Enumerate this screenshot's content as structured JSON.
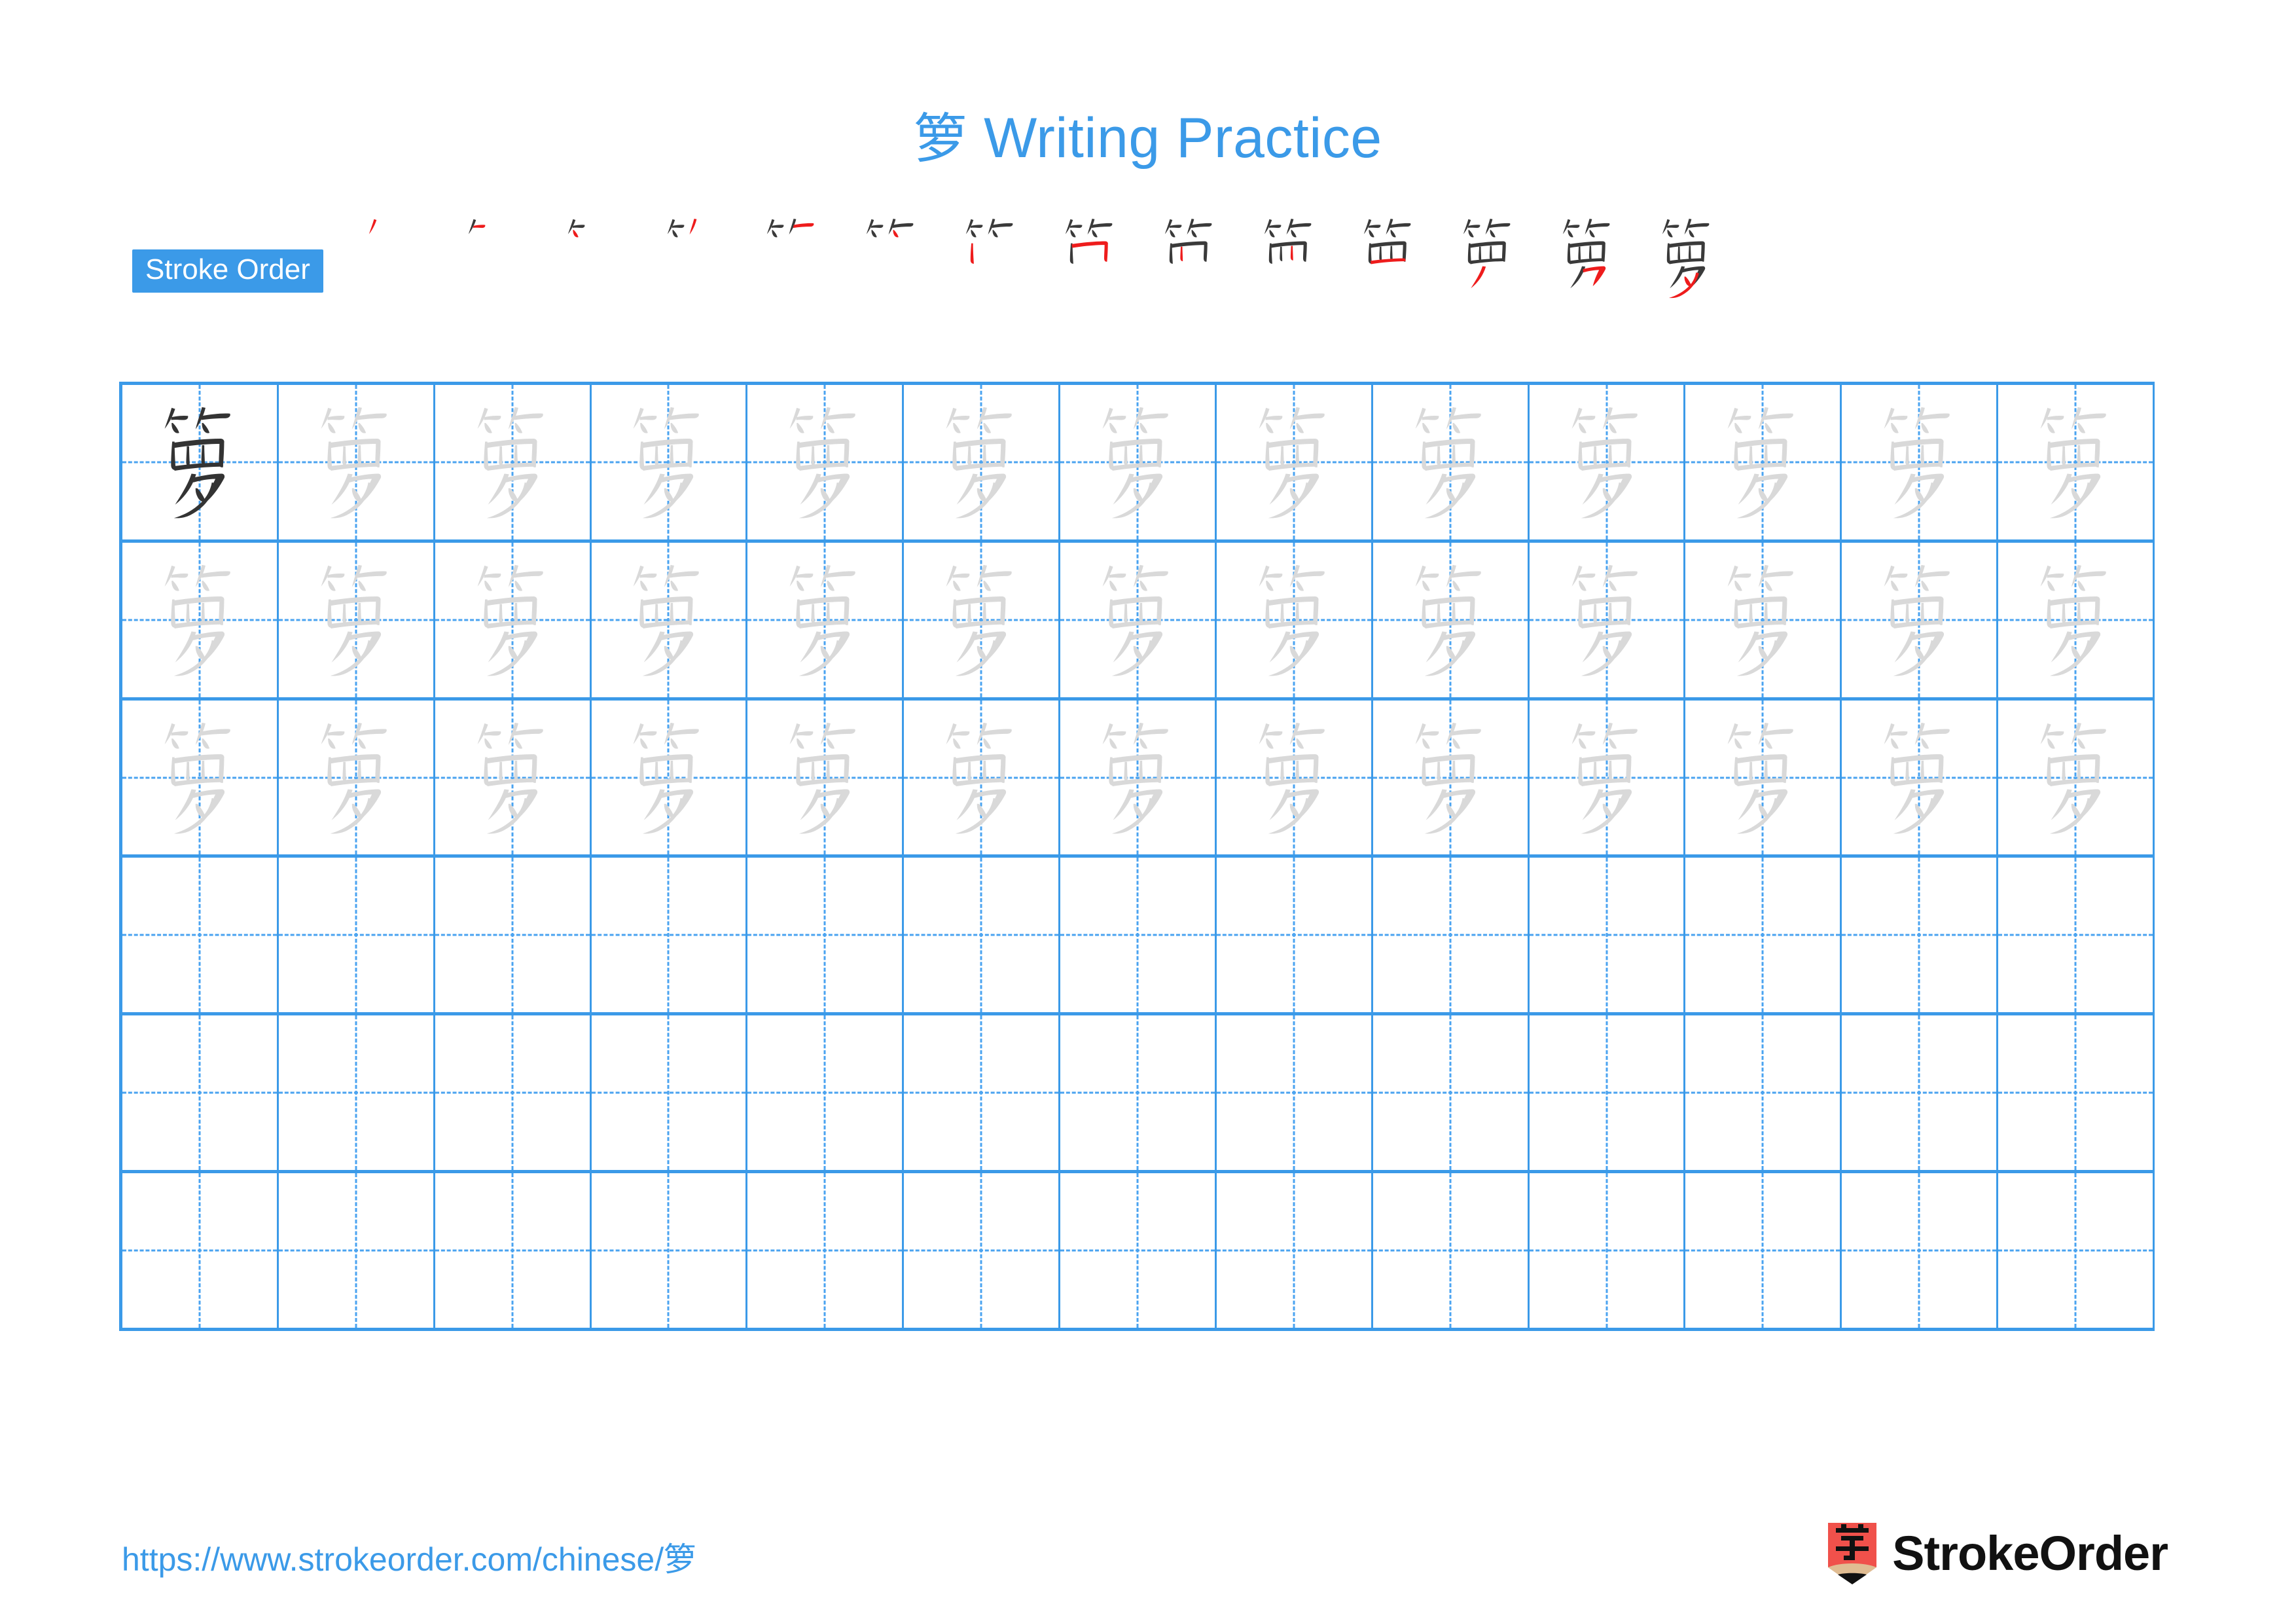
{
  "character": "箩",
  "title": {
    "character": "箩",
    "text": " Writing Practice",
    "full": "箩 Writing Practice",
    "color": "#3b9ae8"
  },
  "stroke_order": {
    "badge_label": "Stroke Order",
    "badge_bg": "#3b9ae8",
    "badge_text_color": "#ffffff",
    "total_strokes": 14,
    "new_stroke_color": "#ee1c1c",
    "prior_stroke_color": "#3a3a3a",
    "steps": [
      {
        "index": 1,
        "new_stroke": "撇 (piě)"
      },
      {
        "index": 2,
        "new_stroke": "横 (héng)"
      },
      {
        "index": 3,
        "new_stroke": "点 (diǎn)"
      },
      {
        "index": 4,
        "new_stroke": "撇 (piě)"
      },
      {
        "index": 5,
        "new_stroke": "横 (héng)"
      },
      {
        "index": 6,
        "new_stroke": "点 (diǎn)"
      },
      {
        "index": 7,
        "new_stroke": "竖 (shù)"
      },
      {
        "index": 8,
        "new_stroke": "横折 (héngzhé)"
      },
      {
        "index": 9,
        "new_stroke": "竖 (shù)"
      },
      {
        "index": 10,
        "new_stroke": "竖 (shù)"
      },
      {
        "index": 11,
        "new_stroke": "横 (héng)"
      },
      {
        "index": 12,
        "new_stroke": "撇 (piě)"
      },
      {
        "index": 13,
        "new_stroke": "横撇/横钩 (héngpiě)"
      },
      {
        "index": 14,
        "new_stroke": "撇 (piě)"
      }
    ]
  },
  "practice_grid": {
    "columns": 13,
    "rows": 6,
    "grid_line_color": "#3b9ae8",
    "guide_line_color": "#4aa3f0",
    "model_char_color": "#333333",
    "trace_char_color": "#d9d9d9",
    "row_types": [
      "model-and-trace",
      "trace",
      "trace",
      "blank",
      "blank",
      "blank"
    ],
    "model_cell": {
      "row": 1,
      "column": 1,
      "character": "箩"
    },
    "trace_character": "箩"
  },
  "footer": {
    "url": "https://www.strokeorder.com/chinese/",
    "url_character": "箩",
    "url_full": "https://www.strokeorder.com/chinese/箩",
    "url_color": "#3b9ae8",
    "brand_name": "StrokeOrder",
    "logo_character": "字",
    "logo_body_color": "#f0514b",
    "logo_wood_color": "#e0bc92",
    "logo_tip_color": "#111111"
  }
}
